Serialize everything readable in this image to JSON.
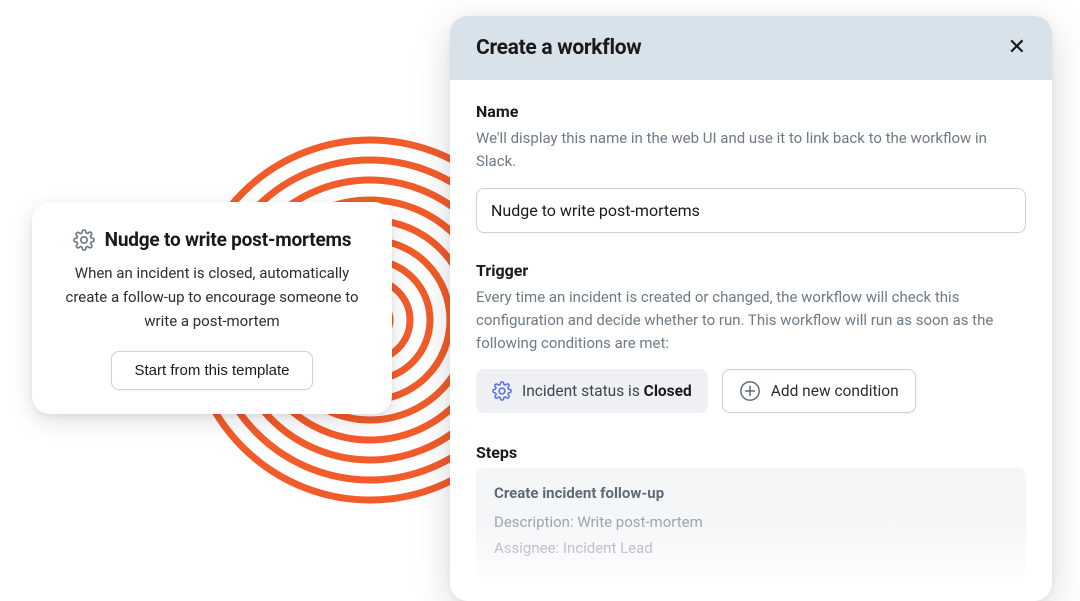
{
  "template_card": {
    "title": "Nudge to write post-mortems",
    "description": "When an incident is closed, automatically create a follow-up to encourage someone to write a post-mortem",
    "button_label": "Start from this template"
  },
  "panel": {
    "title": "Create a workflow",
    "name": {
      "label": "Name",
      "hint": "We'll display this name in the web UI and use it to link back to the workflow in Slack.",
      "value": "Nudge to write post-mortems"
    },
    "trigger": {
      "label": "Trigger",
      "hint": "Every time an incident is created or changed, the workflow will check this configuration and decide whether to run. This workflow will run as soon as the following conditions are met:",
      "condition_prefix": "Incident status is ",
      "condition_value": "Closed",
      "add_label": "Add new condition"
    },
    "steps": {
      "label": "Steps",
      "step_title": "Create incident follow-up",
      "description_label": "Description:",
      "description_value": "Write post-mortem",
      "assignee_label": "Assignee:",
      "assignee_value": "Incident Lead"
    }
  }
}
